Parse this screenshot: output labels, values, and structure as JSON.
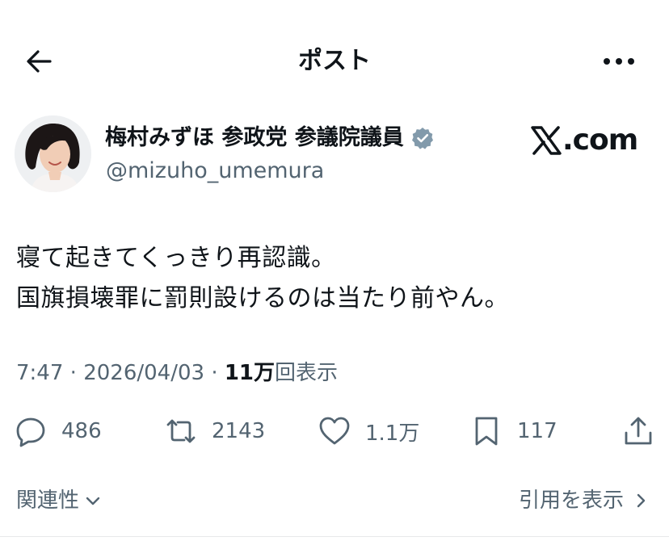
{
  "header": {
    "title": "ポスト",
    "back_icon": "arrow-left-icon",
    "more_icon": "more-horizontal-icon"
  },
  "author": {
    "display_name": "梅村みずほ 参政党 参議院議員",
    "handle": "@mizuho_umemura",
    "verified_icon": "verified-badge-icon",
    "verified_color": "#829aab"
  },
  "watermark": {
    "mark": "𝕏",
    "text": ".com"
  },
  "post": {
    "lines": [
      "寝て起きてくっきり再認識。",
      "国旗損壊罪に罰則設けるのは当たり前やん。"
    ],
    "time": "7:47",
    "separator": "·",
    "date": "2026/04/03",
    "views_count": "11万",
    "views_label": "回表示"
  },
  "actions": {
    "reply": {
      "icon": "reply-icon",
      "count": "486"
    },
    "repost": {
      "icon": "repost-icon",
      "count": "2143"
    },
    "like": {
      "icon": "heart-icon",
      "count": "1.1万"
    },
    "bookmark": {
      "icon": "bookmark-icon",
      "count": "117"
    },
    "share": {
      "icon": "share-icon"
    }
  },
  "footer": {
    "related_label": "関連性",
    "quotes_label": "引用を表示"
  },
  "colors": {
    "text": "#0f1419",
    "secondary": "#536471",
    "divider": "#e7e9ea"
  }
}
